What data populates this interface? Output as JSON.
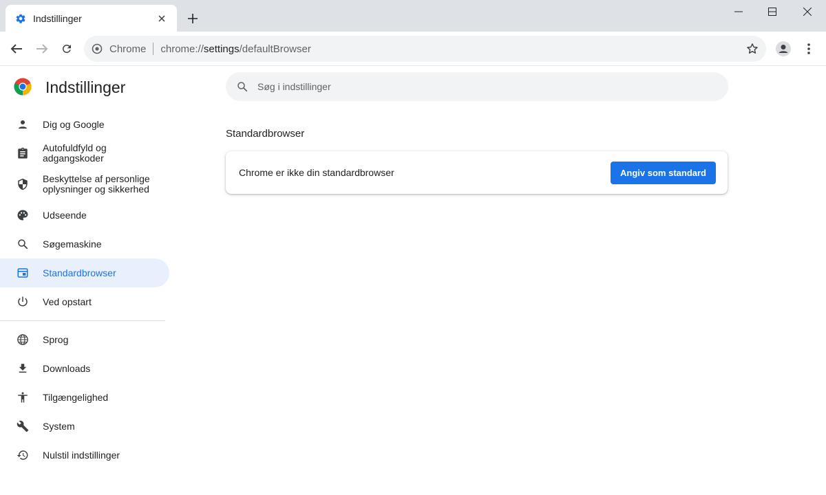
{
  "window": {
    "tab_title": "Indstillinger",
    "tab_favicon": "settings-gear-icon",
    "accent": "#1a73e8"
  },
  "toolbar": {
    "site_name": "Chrome",
    "url_scheme": "chrome://",
    "url_host": "settings",
    "url_path": "/defaultBrowser"
  },
  "sidebar": {
    "title": "Indstillinger",
    "items": [
      {
        "label": "Dig og Google",
        "icon": "person-icon"
      },
      {
        "label": "Autofuldfyld og adgangskoder",
        "icon": "clipboard-icon"
      },
      {
        "label": "Beskyttelse af personlige oplysninger og sikkerhed",
        "icon": "shield-icon"
      },
      {
        "label": "Udseende",
        "icon": "palette-icon"
      },
      {
        "label": "Søgemaskine",
        "icon": "search-icon"
      },
      {
        "label": "Standardbrowser",
        "icon": "browser-window-icon",
        "active": true
      },
      {
        "label": "Ved opstart",
        "icon": "power-icon"
      },
      {
        "label": "Sprog",
        "icon": "globe-icon"
      },
      {
        "label": "Downloads",
        "icon": "download-icon"
      },
      {
        "label": "Tilgængelighed",
        "icon": "accessibility-icon"
      },
      {
        "label": "System",
        "icon": "wrench-icon"
      },
      {
        "label": "Nulstil indstillinger",
        "icon": "reset-icon"
      }
    ]
  },
  "main": {
    "search_placeholder": "Søg i indstillinger",
    "section_title": "Standardbrowser",
    "card_text": "Chrome er ikke din standardbrowser",
    "card_button": "Angiv som standard"
  }
}
